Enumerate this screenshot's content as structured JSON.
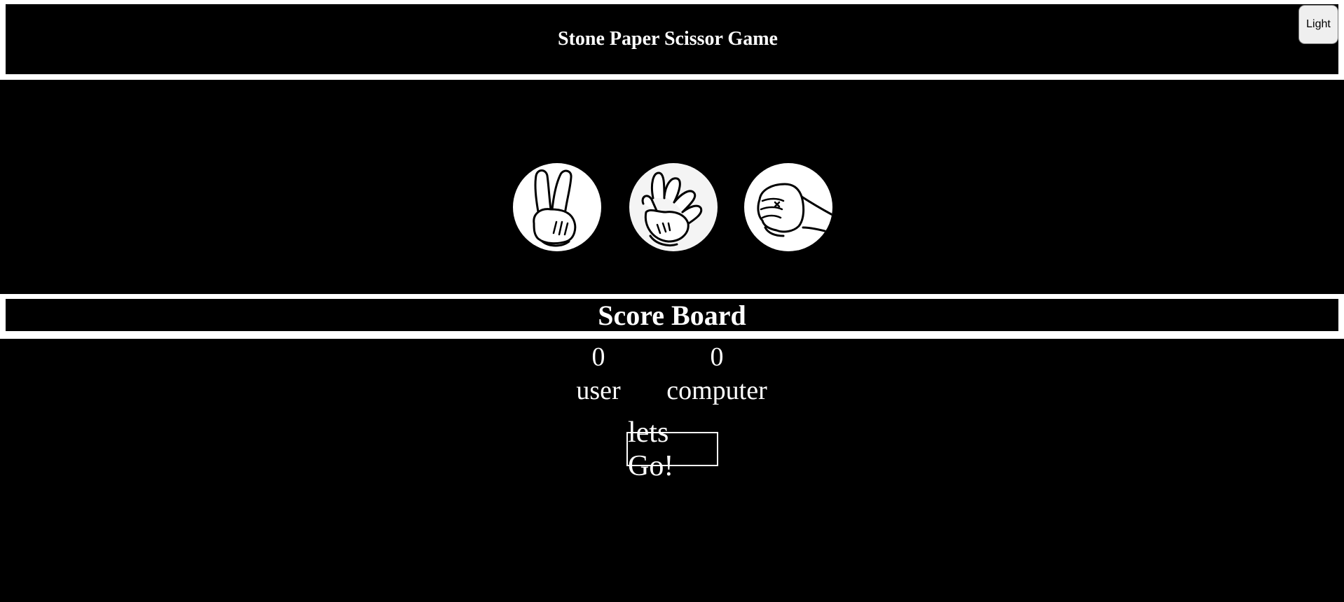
{
  "header": {
    "title": "Stone Paper Scissor Game",
    "theme_button_label": "Light"
  },
  "choices": [
    {
      "name": "scissor",
      "icon": "scissor-hand-icon"
    },
    {
      "name": "paper",
      "icon": "paper-hand-icon"
    },
    {
      "name": "stone",
      "icon": "stone-fist-icon"
    }
  ],
  "scoreboard": {
    "title": "Score Board",
    "user_score": "0",
    "user_label": "user",
    "computer_score": "0",
    "computer_label": "computer"
  },
  "play_button_label": "lets Go!",
  "colors": {
    "background": "#000000",
    "foreground": "#ffffff"
  }
}
